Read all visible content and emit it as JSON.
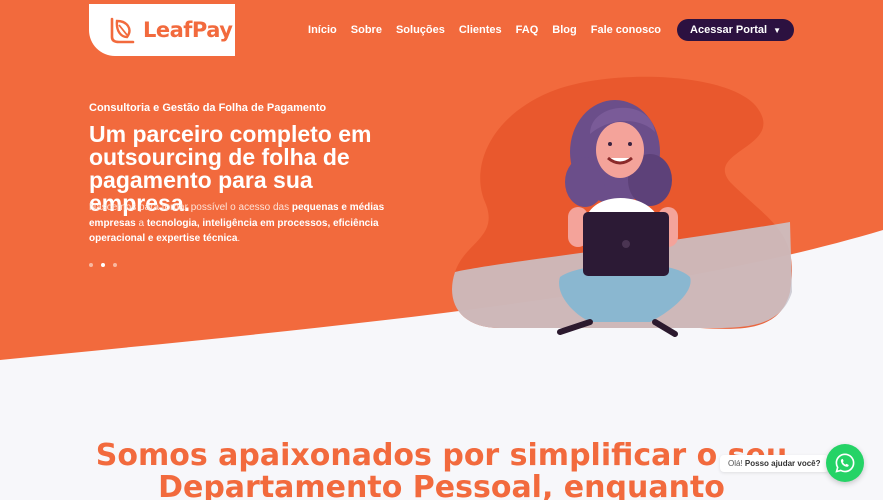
{
  "brand": {
    "name": "LeafPay"
  },
  "nav": {
    "items": [
      "Início",
      "Sobre",
      "Soluções",
      "Clientes",
      "FAQ",
      "Blog",
      "Fale conosco"
    ],
    "portal_label": "Acessar Portal"
  },
  "hero": {
    "eyebrow": "Consultoria e Gestão da Folha de Pagamento",
    "headline": "Um parceiro completo em outsourcing de folha de pagamento para sua empresa.",
    "sub_plain_1": "Nascemos para tornar possível o acesso das ",
    "sub_bold_1": "pequenas e médias empresas",
    "sub_plain_2": " a ",
    "sub_bold_2": "tecnologia, inteligência em processos, eficiência operacional e expertise técnica",
    "sub_plain_3": ".",
    "slides": 3,
    "active_slide": 2
  },
  "section": {
    "title": "Somos apaixonados por simplificar o seu Departamento Pessoal, enquanto"
  },
  "chat": {
    "greeting": "Olá!",
    "prompt": "Posso ajudar você?"
  },
  "colors": {
    "brand_orange": "#f26a3d",
    "portal_purple": "#2c1140",
    "whatsapp_green": "#25d366"
  },
  "icons": [
    "leaf-logo-icon",
    "chevron-down-icon",
    "laptop-icon",
    "whatsapp-icon"
  ]
}
